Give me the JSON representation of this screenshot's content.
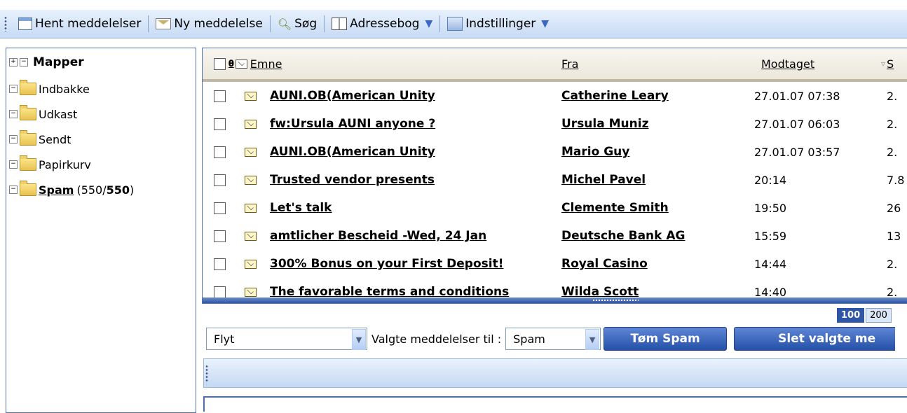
{
  "toolbar": {
    "fetch_label": "Hent meddelelser",
    "new_label": "Ny meddelelse",
    "search_label": "Søg",
    "addressbook_label": "Adressebog",
    "settings_label": "Indstillinger"
  },
  "folders": {
    "title": "Mapper",
    "items": [
      {
        "name": "Indbakke"
      },
      {
        "name": "Udkast"
      },
      {
        "name": "Sendt"
      },
      {
        "name": "Papirkurv"
      },
      {
        "name": "Spam",
        "count": "(550/",
        "count_bold": "550",
        "count_end": ")"
      }
    ]
  },
  "messages": {
    "columns": {
      "subject": "Emne",
      "from": "Fra",
      "received": "Modtaget",
      "size": "S"
    },
    "rows": [
      {
        "subject": "AUNI.OB(American Unity",
        "from": "Catherine Leary",
        "received": "27.01.07 07:38",
        "size": "2."
      },
      {
        "subject": "fw:Ursula AUNI anyone ?",
        "from": "Ursula Muniz",
        "received": "27.01.07 06:03",
        "size": "2."
      },
      {
        "subject": "AUNI.OB(American Unity",
        "from": "Mario Guy",
        "received": "27.01.07 03:57",
        "size": "2."
      },
      {
        "subject": "Trusted vendor presents",
        "from": "Michel Pavel",
        "received": "20:14",
        "size": "7.8"
      },
      {
        "subject": "Let's talk",
        "from": "Clemente Smith",
        "received": "19:50",
        "size": "26"
      },
      {
        "subject": "amtlicher Bescheid -Wed, 24 Jan",
        "from": "Deutsche Bank AG",
        "received": "15:59",
        "size": "13"
      },
      {
        "subject": "300% Bonus on your First Deposit!",
        "from": "Royal Casino",
        "received": "14:44",
        "size": "2."
      },
      {
        "subject": "The favorable terms and conditions",
        "from": "Wilda Scott",
        "received": "14:40",
        "size": "2."
      }
    ]
  },
  "paging": {
    "p100": "100",
    "p200": "200"
  },
  "actions": {
    "move_select": "Flyt",
    "to_label": "Valgte meddelelser til :",
    "target_select": "Spam",
    "empty_spam": "Tøm Spam",
    "delete_selected": "Slet valgte me"
  },
  "colors": {
    "accent": "#2f56a6",
    "toolbar_bg": "#c6dbf5",
    "header_bg": "#ebe7da"
  }
}
